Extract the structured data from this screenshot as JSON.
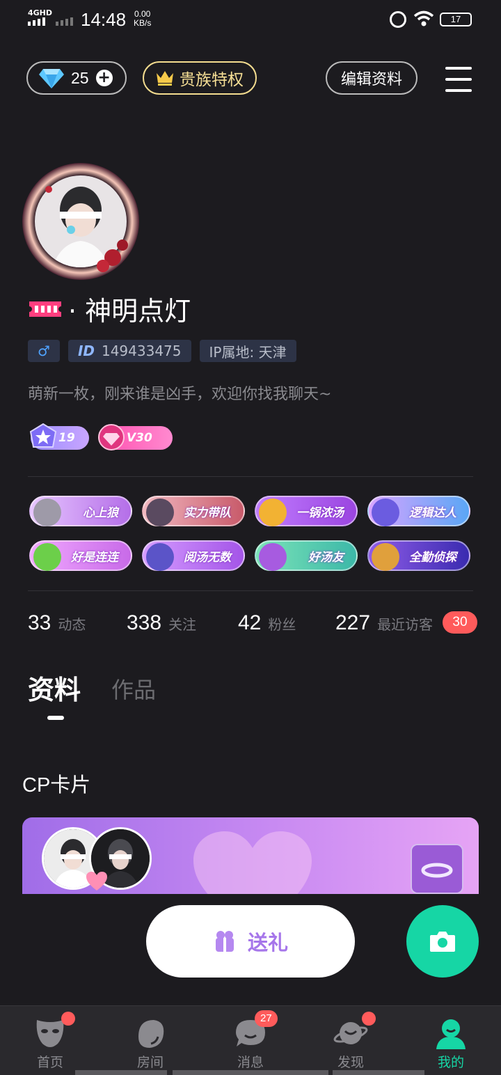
{
  "status_bar": {
    "network": "4GHD",
    "time": "14:48",
    "speed_value": "0.00",
    "speed_unit": "KB/s",
    "battery": "17"
  },
  "top_bar": {
    "diamond_count": "25",
    "noble_label": "贵族特权",
    "edit_label": "编辑资料"
  },
  "profile": {
    "nickname": "· 神明点灯",
    "gender_symbol": "♂",
    "id_prefix": "ID",
    "id_value": "149433475",
    "ip_location": "IP属地: 天津",
    "bio": "萌新一枚，刚来谁是凶手，欢迎你找我聊天~",
    "level_star": "19",
    "level_vip": "V30"
  },
  "badges": [
    {
      "label": "心上狼",
      "color": "#b46ee8"
    },
    {
      "label": "实力带队",
      "color": "#c85a6a"
    },
    {
      "label": "一锅浓汤",
      "color": "#9b45e0"
    },
    {
      "label": "逻辑达人",
      "color": "#7a6cf0"
    },
    {
      "label": "好是连连",
      "color": "#c86ae8"
    },
    {
      "label": "阅汤无数",
      "color": "#a455e8"
    },
    {
      "label": "好汤友",
      "color": "#3cb8a8"
    },
    {
      "label": "全勤侦探",
      "color": "#6a3cd0"
    }
  ],
  "stats": {
    "posts_count": "33",
    "posts_label": "动态",
    "following_count": "338",
    "following_label": "关注",
    "fans_count": "42",
    "fans_label": "粉丝",
    "visitors_count": "227",
    "visitors_label": "最近访客",
    "visitors_new": "30"
  },
  "tabs": {
    "active": "资料",
    "inactive": "作品"
  },
  "section": {
    "cp_title": "CP卡片"
  },
  "actions": {
    "gift_label": "送礼"
  },
  "bottom_nav": [
    {
      "label": "首页"
    },
    {
      "label": "房间"
    },
    {
      "label": "消息",
      "count": "27"
    },
    {
      "label": "发现"
    },
    {
      "label": "我的"
    }
  ],
  "colors": {
    "background": "#1c1b1f",
    "accent_green": "#16d6a5",
    "gold": "#f6df95",
    "badge_red": "#ff5b5b",
    "gift_purple": "#a676ea"
  }
}
